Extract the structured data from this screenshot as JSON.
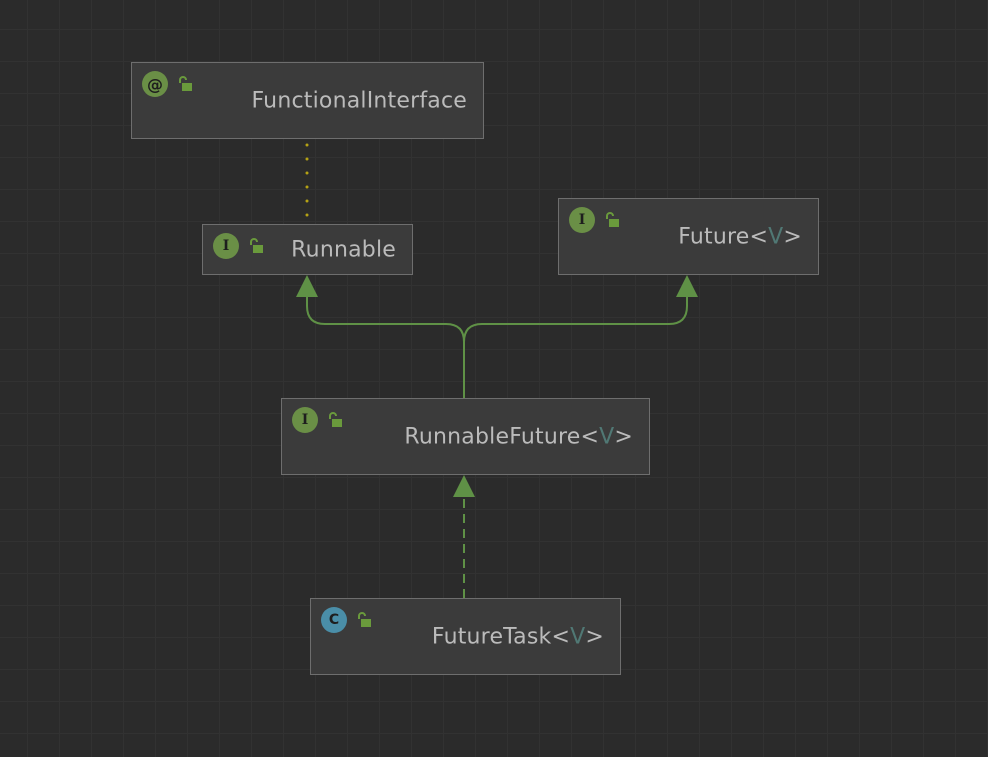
{
  "colors": {
    "background": "#2b2b2b",
    "node_fill": "#3b3b3b",
    "node_border": "#6e6e6e",
    "text": "#bbbbbb",
    "type_param": "#507874",
    "edge_inheritance": "#5f9146",
    "edge_annotation": "#b5a214",
    "badge_interface": "#6a8f46",
    "badge_class": "#4a8ea8"
  },
  "nodes": [
    {
      "id": "functional-interface",
      "kind": "annotation",
      "badge": "@",
      "icon": "unlocked-padlock-icon",
      "name": "FunctionalInterface",
      "type_param": ""
    },
    {
      "id": "runnable",
      "kind": "interface",
      "badge": "I",
      "icon": "unlocked-padlock-icon",
      "name": "Runnable",
      "type_param": ""
    },
    {
      "id": "future",
      "kind": "interface",
      "badge": "I",
      "icon": "unlocked-padlock-icon",
      "name": "Future",
      "type_param": "V"
    },
    {
      "id": "runnable-future",
      "kind": "interface",
      "badge": "I",
      "icon": "unlocked-padlock-icon",
      "name": "RunnableFuture",
      "type_param": "V"
    },
    {
      "id": "future-task",
      "kind": "class",
      "badge": "C",
      "icon": "unlocked-padlock-icon",
      "name": "FutureTask",
      "type_param": "V"
    }
  ],
  "edges": [
    {
      "from": "runnable",
      "to": "functional-interface",
      "style": "dotted",
      "relation": "annotated-with"
    },
    {
      "from": "runnable-future",
      "to": "runnable",
      "style": "solid",
      "relation": "extends"
    },
    {
      "from": "runnable-future",
      "to": "future",
      "style": "solid",
      "relation": "extends"
    },
    {
      "from": "future-task",
      "to": "runnable-future",
      "style": "dashed",
      "relation": "implements"
    }
  ]
}
